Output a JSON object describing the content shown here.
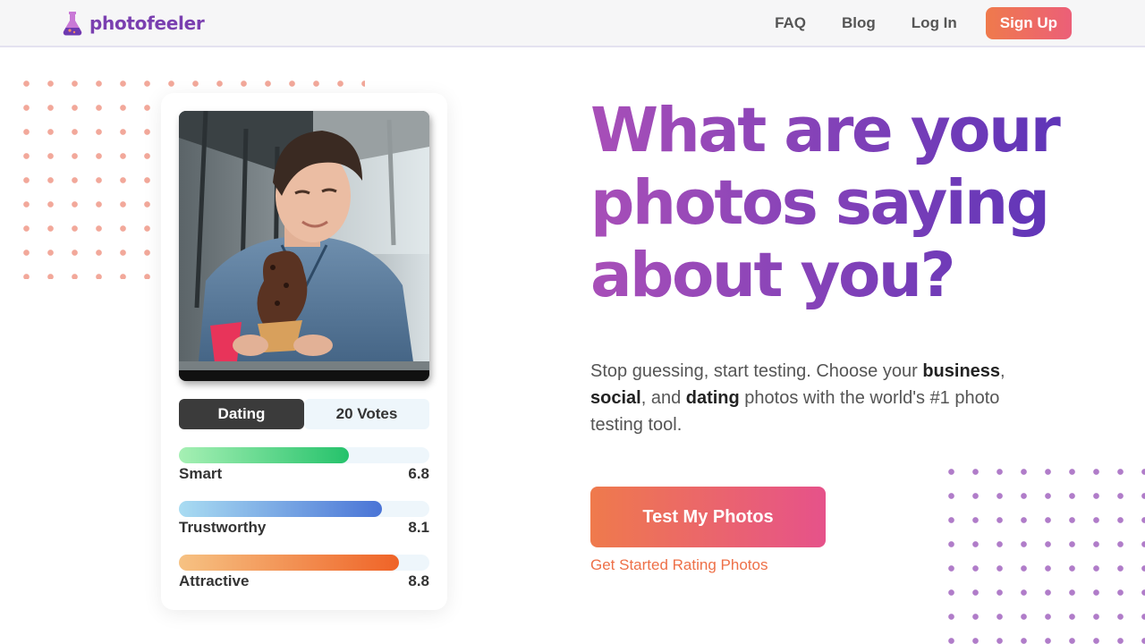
{
  "header": {
    "logo_text": "photofeeler",
    "nav": {
      "faq": "FAQ",
      "blog": "Blog",
      "login": "Log In",
      "signup": "Sign Up"
    }
  },
  "card": {
    "tabs": {
      "category": "Dating",
      "votes": "20 Votes"
    },
    "metrics": [
      {
        "label": "Smart",
        "value": "6.8",
        "fraction": 0.68,
        "gradient": [
          "#a6f0b4",
          "#25c26b"
        ]
      },
      {
        "label": "Trustworthy",
        "value": "8.1",
        "fraction": 0.81,
        "gradient": [
          "#a9dcf2",
          "#4a74d6"
        ]
      },
      {
        "label": "Attractive",
        "value": "8.8",
        "fraction": 0.88,
        "gradient": [
          "#f6c283",
          "#ef6327"
        ]
      }
    ]
  },
  "hero": {
    "headline": "What are your photos saying about you?",
    "sub": {
      "p1": "Stop guessing, start testing. Choose your ",
      "b1": "business",
      "p2": ", ",
      "b2": "social",
      "p3": ", and ",
      "b3": "dating",
      "p4": " photos with the world's #1 photo testing tool."
    },
    "cta_label": "Test My Photos",
    "cta_link": "Get Started Rating Photos"
  },
  "colors": {
    "brand_purple": "#7a3fb0",
    "accent_orange": "#ef7a4c",
    "accent_pink": "#e6528a",
    "dots_left": "#f2a89a",
    "dots_right": "#b07cc9"
  },
  "icons": {
    "logo": "flask-icon"
  }
}
